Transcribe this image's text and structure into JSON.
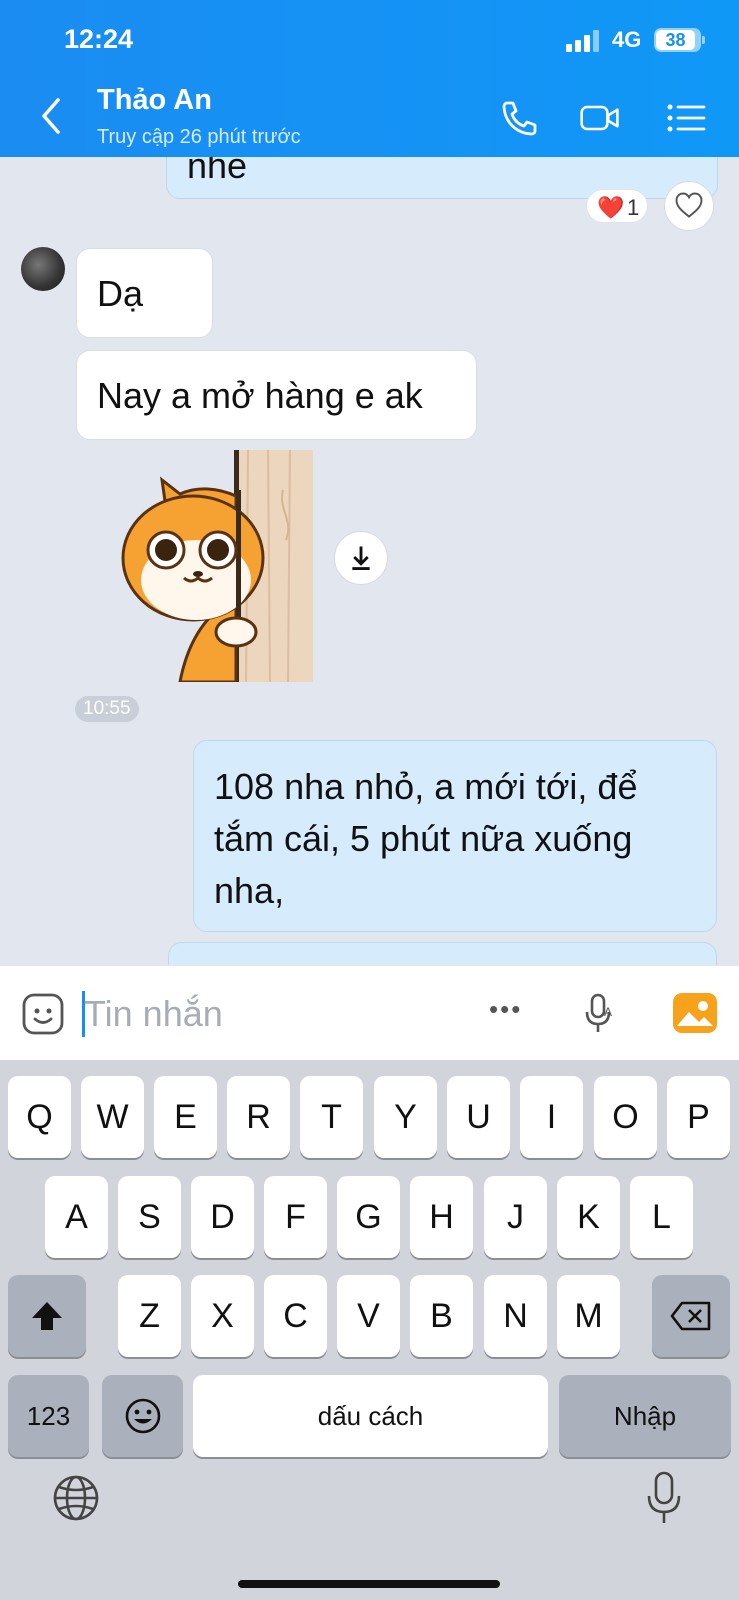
{
  "status_bar": {
    "time": "12:24",
    "network": "4G",
    "battery": "38"
  },
  "header": {
    "title": "Thảo An",
    "subtitle": "Truy cập 26 phút trước"
  },
  "chat": {
    "top_partial_text": "nhé",
    "reaction": {
      "emoji": "❤️",
      "count": "1"
    },
    "messages": [
      {
        "text": "Dạ"
      },
      {
        "text": "Nay a mở hàng e ak"
      },
      {
        "time": "10:55"
      },
      {
        "line1": "108 nha nhỏ, a mới tới, để",
        "line2": "tắm cái, 5 phút nữa xuống",
        "line3": "nha,"
      }
    ]
  },
  "input": {
    "placeholder": "Tin nhắn",
    "more_icon": "•••"
  },
  "keyboard": {
    "row1": [
      "Q",
      "W",
      "E",
      "R",
      "T",
      "Y",
      "U",
      "I",
      "O",
      "P"
    ],
    "row2": [
      "A",
      "S",
      "D",
      "F",
      "G",
      "H",
      "J",
      "K",
      "L"
    ],
    "row3": [
      "Z",
      "X",
      "C",
      "V",
      "B",
      "N",
      "M"
    ],
    "numbers_key": "123",
    "space_label": "dấu cách",
    "return_label": "Nhập"
  },
  "colors": {
    "header": "#1a8cf2",
    "outgoing_bubble": "#d6ecfd",
    "keyboard": "#d1d4db"
  }
}
